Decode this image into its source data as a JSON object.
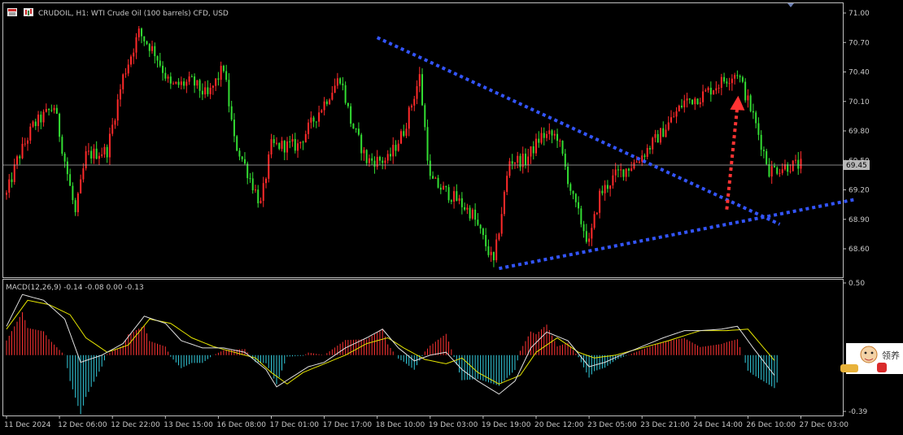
{
  "header": {
    "title": "CRUDOIL, H1:  WTI Crude Oil (100 barrels) CFD, USD"
  },
  "macd_header": "MACD(12,26,9) -0.14 -0.08 0.00 -0.13",
  "overlay_widget": {
    "text": "领养"
  },
  "colors": {
    "background": "#000000",
    "bull": "#ff2a2a",
    "bear": "#33dd33",
    "trendline": "#3355ff",
    "arrow": "#ff3333",
    "hist_up": "#ff3333",
    "hist_down": "#33ccdd",
    "macd_line": "#e0e0e0",
    "signal_line": "#e6e600",
    "price_line": "#b0b0b0"
  },
  "chart_data": [
    {
      "type": "candlestick",
      "title": "CRUDOIL, H1",
      "y_ticks": [
        "71.00",
        "70.70",
        "70.40",
        "70.10",
        "69.80",
        "69.50",
        "69.20",
        "68.90",
        "68.60"
      ],
      "ylim": [
        68.35,
        71.05
      ],
      "current_price": "69.45",
      "x_ticks": [
        "11 Dec 2024",
        "12 Dec 06:00",
        "12 Dec 22:00",
        "13 Dec 15:00",
        "16 Dec 08:00",
        "17 Dec 01:00",
        "17 Dec 17:00",
        "18 Dec 10:00",
        "19 Dec 03:00",
        "19 Dec 19:00",
        "20 Dec 12:00",
        "23 Dec 05:00",
        "23 Dec 21:00",
        "24 Dec 14:00",
        "26 Dec 10:00",
        "27 Dec 03:00"
      ],
      "close_path": [
        [
          0,
          69.15
        ],
        [
          4,
          69.5
        ],
        [
          10,
          69.85
        ],
        [
          18,
          70.05
        ],
        [
          26,
          68.95
        ],
        [
          30,
          69.55
        ],
        [
          38,
          69.6
        ],
        [
          44,
          70.35
        ],
        [
          50,
          70.8
        ],
        [
          56,
          70.6
        ],
        [
          62,
          70.25
        ],
        [
          70,
          70.3
        ],
        [
          76,
          70.15
        ],
        [
          82,
          70.45
        ],
        [
          86,
          69.7
        ],
        [
          90,
          69.45
        ],
        [
          96,
          69.05
        ],
        [
          100,
          69.65
        ],
        [
          110,
          69.65
        ],
        [
          118,
          70.0
        ],
        [
          126,
          70.35
        ],
        [
          130,
          69.9
        ],
        [
          136,
          69.5
        ],
        [
          144,
          69.5
        ],
        [
          150,
          69.8
        ],
        [
          156,
          70.35
        ],
        [
          160,
          69.3
        ],
        [
          170,
          69.1
        ],
        [
          176,
          68.95
        ],
        [
          184,
          68.45
        ],
        [
          190,
          69.5
        ],
        [
          196,
          69.5
        ],
        [
          202,
          69.75
        ],
        [
          208,
          69.75
        ],
        [
          214,
          69.1
        ],
        [
          220,
          68.65
        ],
        [
          224,
          69.15
        ],
        [
          230,
          69.35
        ],
        [
          236,
          69.45
        ],
        [
          240,
          69.55
        ],
        [
          248,
          69.8
        ],
        [
          256,
          70.1
        ],
        [
          262,
          70.15
        ],
        [
          270,
          70.3
        ],
        [
          276,
          70.4
        ],
        [
          282,
          69.95
        ],
        [
          288,
          69.4
        ],
        [
          296,
          69.45
        ],
        [
          300,
          69.45
        ]
      ],
      "trendlines": [
        {
          "from": [
            140,
            70.75
          ],
          "to": [
            292,
            68.85
          ],
          "color": "blue",
          "style": "dotted"
        },
        {
          "from": [
            186,
            68.4
          ],
          "to": [
            320,
            69.1
          ],
          "color": "blue",
          "style": "dotted"
        }
      ],
      "annotation": {
        "type": "arrow",
        "direction": "up",
        "from": [
          272,
          69.0
        ],
        "to": [
          276,
          70.1
        ],
        "color": "red",
        "style": "dotted"
      }
    },
    {
      "type": "histogram+line",
      "title": "MACD(12,26,9)",
      "y_ticks": [
        "0.50",
        "-0.39"
      ],
      "ylim": [
        -0.45,
        0.55
      ],
      "macd": [
        [
          0,
          0.2
        ],
        [
          6,
          0.42
        ],
        [
          14,
          0.38
        ],
        [
          22,
          0.25
        ],
        [
          28,
          -0.05
        ],
        [
          36,
          0.0
        ],
        [
          44,
          0.08
        ],
        [
          52,
          0.27
        ],
        [
          60,
          0.22
        ],
        [
          66,
          0.1
        ],
        [
          74,
          0.05
        ],
        [
          82,
          0.05
        ],
        [
          90,
          0.02
        ],
        [
          98,
          -0.1
        ],
        [
          102,
          -0.22
        ],
        [
          108,
          -0.15
        ],
        [
          114,
          -0.08
        ],
        [
          120,
          -0.05
        ],
        [
          128,
          0.05
        ],
        [
          136,
          0.12
        ],
        [
          142,
          0.18
        ],
        [
          148,
          0.05
        ],
        [
          154,
          -0.04
        ],
        [
          160,
          0.0
        ],
        [
          166,
          0.02
        ],
        [
          172,
          -0.1
        ],
        [
          178,
          -0.18
        ],
        [
          186,
          -0.27
        ],
        [
          192,
          -0.18
        ],
        [
          198,
          0.05
        ],
        [
          204,
          0.16
        ],
        [
          212,
          0.1
        ],
        [
          220,
          -0.08
        ],
        [
          226,
          -0.05
        ],
        [
          232,
          0.0
        ],
        [
          240,
          0.06
        ],
        [
          248,
          0.12
        ],
        [
          256,
          0.17
        ],
        [
          262,
          0.17
        ],
        [
          270,
          0.18
        ],
        [
          276,
          0.2
        ],
        [
          282,
          0.05
        ],
        [
          290,
          -0.14
        ]
      ],
      "signal": [
        [
          0,
          0.18
        ],
        [
          8,
          0.38
        ],
        [
          16,
          0.35
        ],
        [
          24,
          0.28
        ],
        [
          30,
          0.12
        ],
        [
          38,
          0.02
        ],
        [
          46,
          0.07
        ],
        [
          54,
          0.25
        ],
        [
          62,
          0.22
        ],
        [
          70,
          0.12
        ],
        [
          78,
          0.06
        ],
        [
          86,
          0.02
        ],
        [
          94,
          -0.02
        ],
        [
          100,
          -0.12
        ],
        [
          106,
          -0.2
        ],
        [
          112,
          -0.12
        ],
        [
          120,
          -0.06
        ],
        [
          128,
          0.0
        ],
        [
          136,
          0.08
        ],
        [
          144,
          0.12
        ],
        [
          150,
          0.05
        ],
        [
          158,
          -0.03
        ],
        [
          166,
          -0.06
        ],
        [
          172,
          -0.02
        ],
        [
          178,
          -0.12
        ],
        [
          186,
          -0.2
        ],
        [
          194,
          -0.14
        ],
        [
          200,
          0.02
        ],
        [
          208,
          0.12
        ],
        [
          216,
          0.02
        ],
        [
          222,
          -0.02
        ],
        [
          230,
          0.0
        ],
        [
          240,
          0.05
        ],
        [
          250,
          0.1
        ],
        [
          262,
          0.17
        ],
        [
          272,
          0.17
        ],
        [
          280,
          0.18
        ],
        [
          286,
          0.05
        ],
        [
          292,
          -0.08
        ]
      ]
    }
  ]
}
